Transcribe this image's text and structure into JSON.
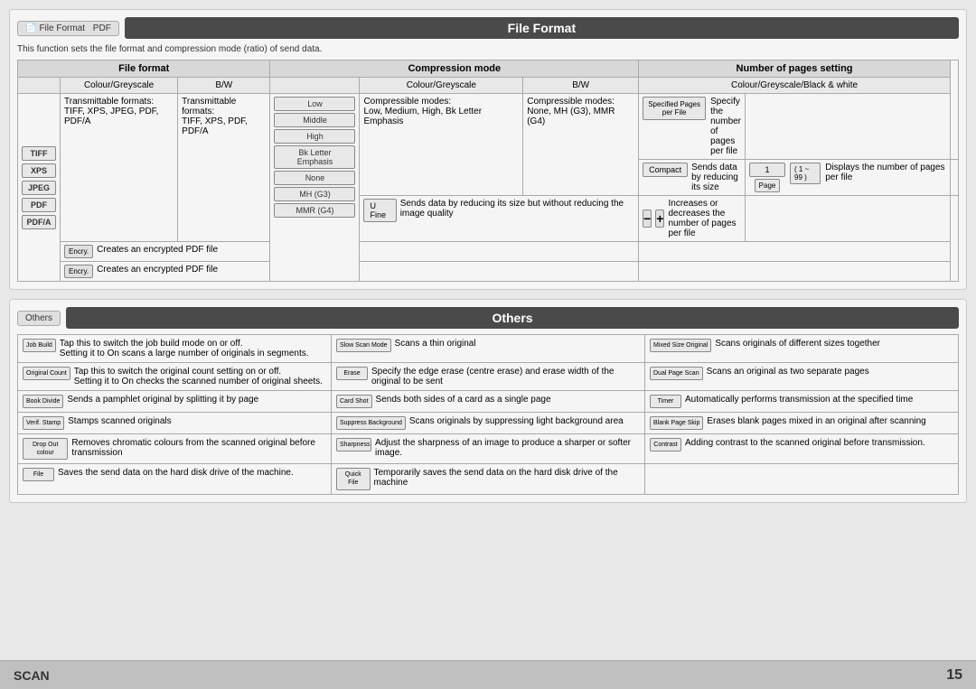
{
  "fileformat": {
    "tab_label": "File Format",
    "tab_icon": "📄",
    "pdf_label": "PDF",
    "title": "File Format",
    "description": "This function sets the file format and compression mode (ratio) of send data.",
    "col_file_format": "File format",
    "col_compression": "Compression mode",
    "col_pages": "Number of pages setting",
    "sub_colour": "Colour/Greyscale",
    "sub_bw": "B/W",
    "sub_colour2": "Colour/Greyscale",
    "sub_bw2": "B/W",
    "sub_colour_bw_white": "Colour/Greyscale/Black & white",
    "formats": [
      "TIFF",
      "XPS",
      "JPEG",
      "PDF",
      "PDF/A"
    ],
    "trans_colour": "Transmittable formats:\nTIFF, XPS, JPEG, PDF, PDF/A",
    "trans_bw": "Transmittable formats:\nTIFF, XPS, PDF, PDF/A",
    "encry_label": "Encry.",
    "encry_desc_colour": "Creates an encrypted PDF file",
    "encry_desc_bw": "Creates an encrypted PDF file",
    "compress_modes": [
      "Low",
      "Middle",
      "High",
      "Bk Letter Emphasis",
      "None",
      "MH (G3)",
      "MMR (G4)"
    ],
    "compress_colour_desc": "Compressible modes:\nLow, Medium, High, Bk Letter Emphasis",
    "compress_bw_desc": "Compressible modes:\nNone, MH (G3), MMR (G4)",
    "compact_label": "Compact",
    "compact_desc": "Sends data by reducing its size",
    "ufine_label": "U Fine",
    "ufine_desc": "Sends data by reducing its size but without reducing the image quality",
    "pages_icon_label": "Specified Pages per File",
    "pages_desc1": "Specify the number of pages per file",
    "pages_num": "1",
    "pages_range": "1 ~ 99",
    "page_label": "Page",
    "pages_desc2": "Displays the number of pages per file",
    "pages_desc3": "Increases or decreases the number of pages per file"
  },
  "others": {
    "tab_label": "Others",
    "title": "Others",
    "items": [
      {
        "icon": "Job Build",
        "desc": "Tap this to switch the job build mode on or off.\nSetting it to On scans a large number of originals in segments."
      },
      {
        "icon": "Original Count",
        "desc": "Tap this to switch the original count setting on or off.\nSetting it to On checks the scanned number of original sheets."
      },
      {
        "icon": "Book Divide",
        "desc": "Sends a pamphlet original by splitting it by page"
      },
      {
        "icon": "Verif. Stamp",
        "desc": "Stamps scanned originals"
      },
      {
        "icon": "Drop Out colour",
        "desc": "Removes chromatic colours from the scanned original before transmission"
      },
      {
        "icon": "File",
        "desc": "Saves the send data on the hard disk drive of the machine."
      },
      {
        "icon": "Slow Scan Mode",
        "desc": "Scans a thin original"
      },
      {
        "icon": "Erase",
        "desc": "Specify the edge erase (centre erase) and erase width of the original to be sent"
      },
      {
        "icon": "Card Shot",
        "desc": "Sends both sides of a card as a single page"
      },
      {
        "icon": "Suppress Background",
        "desc": "Scans originals by suppressing light background area"
      },
      {
        "icon": "Sharpness",
        "desc": "Adjust the sharpness of an image to produce a sharper or softer image."
      },
      {
        "icon": "Quick File",
        "desc": "Temporarily saves the send data on the hard disk drive of the machine"
      },
      {
        "icon": "Mixed Size Original",
        "desc": "Scans originals of different sizes together"
      },
      {
        "icon": "Dual Page Scan",
        "desc": "Scans an original as two separate pages"
      },
      {
        "icon": "Timer",
        "desc": "Automatically performs transmission at the specified time"
      },
      {
        "icon": "Blank Page Skip",
        "desc": "Erases blank pages mixed in an original after scanning"
      },
      {
        "icon": "Contrast",
        "desc": "Adding contrast to the scanned original before transmission."
      }
    ]
  },
  "footer": {
    "scan_label": "SCAN",
    "page_number": "15"
  }
}
